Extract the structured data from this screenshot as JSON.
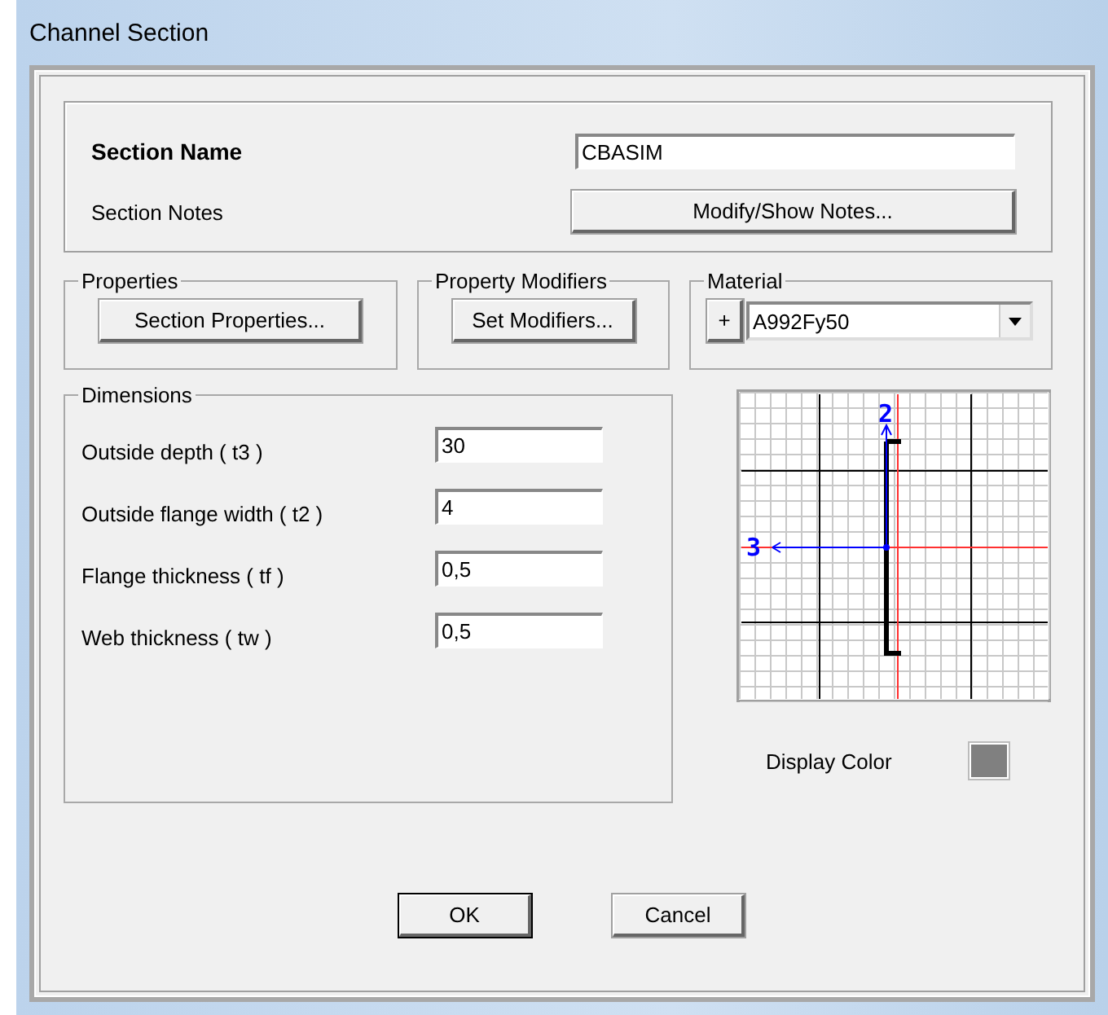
{
  "window": {
    "title": "Channel Section"
  },
  "section": {
    "name_label": "Section Name",
    "name_value": "CBASIM",
    "notes_label": "Section Notes",
    "notes_button": "Modify/Show Notes..."
  },
  "properties": {
    "title": "Properties",
    "button": "Section Properties..."
  },
  "property_modifiers": {
    "title": "Property Modifiers",
    "button": "Set Modifiers..."
  },
  "material": {
    "title": "Material",
    "add_button": "+",
    "value": "A992Fy50"
  },
  "dimensions": {
    "title": "Dimensions",
    "fields": [
      {
        "label": "Outside depth  ( t3 )",
        "value": "30"
      },
      {
        "label": "Outside flange width  ( t2 )",
        "value": "4"
      },
      {
        "label": "Flange thickness  ( tf )",
        "value": "0,5"
      },
      {
        "label": "Web thickness  ( tw )",
        "value": "0,5"
      }
    ]
  },
  "diagram": {
    "axis_2": "2",
    "axis_3": "3"
  },
  "display_color": {
    "label": "Display Color"
  },
  "buttons": [
    "OK",
    "Cancel"
  ]
}
